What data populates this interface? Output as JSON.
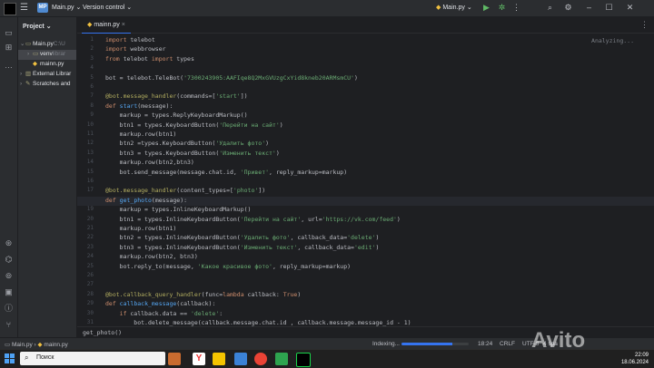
{
  "titlebar": {
    "project_badge": "MP",
    "project_name": "Main.py",
    "vcs": "Version control",
    "run_config": "Main.py"
  },
  "project_panel": {
    "title": "Project",
    "items": [
      {
        "label": "Main.py",
        "hint": "C:\\U",
        "level": 0,
        "expanded": true,
        "selected": false,
        "icon": "folder-icon"
      },
      {
        "label": "venv",
        "hint": "librar",
        "level": 1,
        "expanded": false,
        "selected": true,
        "icon": "folder-icon"
      },
      {
        "label": "mainn.py",
        "hint": "",
        "level": 1,
        "expanded": false,
        "selected": false,
        "icon": "python-file-icon"
      },
      {
        "label": "External Librar",
        "hint": "",
        "level": 0,
        "expanded": false,
        "selected": false,
        "icon": "library-icon"
      },
      {
        "label": "Scratches and",
        "hint": "",
        "level": 0,
        "expanded": false,
        "selected": false,
        "icon": "scratches-icon"
      }
    ]
  },
  "editor": {
    "tab": "mainn.py",
    "analyzing": "Analyzing...",
    "active_line": 18,
    "lines": [
      "import telebot",
      "import webbrowser",
      "from telebot import types",
      "",
      "bot = telebot.TeleBot('7300243905:AAFIqe8Q2MxGVUzgCxYid8kneb20ARMsmCU')",
      "",
      "@bot.message_handler(commands=['start'])",
      "def start(message):",
      "    markup = types.ReplyKeyboardMarkup()",
      "    btn1 = types.KeyboardButton('Перейти на сайт')",
      "    markup.row(btn1)",
      "    btn2 =types.KeyboardButton('Удалить фото')",
      "    btn3 = types.KeyboardButton('Изменить текст')",
      "    markup.row(btn2,btn3)",
      "    bot.send_message(message.chat.id, 'Привет', reply_markup=markup)",
      "",
      "@bot.message_handler(content_types=['photo'])",
      "def get_photo(message):",
      "    markup = types.InlineKeyboardMarkup()",
      "    btn1 = types.InlineKeyboardButton('Перейти на сайт', url='https://vk.com/feed')",
      "    markup.row(btn1)",
      "    btn2 = types.InlineKeyboardButton('Удалить фото', callback_data='delete')",
      "    btn3 = types.InlineKeyboardButton('Изменить текст', callback_data='edit')",
      "    markup.row(btn2, btn3)",
      "    bot.reply_to(message, 'Какое красивое фото', reply_markup=markup)",
      "",
      "",
      "@bot.callback_query_handler(func=lambda callback: True)",
      "def callback_message(callback):",
      "    if callback.data == 'delete':",
      "        bot.delete_message(callback.message.chat.id , callback.message.message_id - 1)"
    ]
  },
  "breadcrumb": "get_photo()",
  "statusbar": {
    "path_root": "Main.py",
    "path_file": "mainn.py",
    "indexing": "Indexing...",
    "progress": 0.75,
    "position": "18:24",
    "line_ending": "CRLF",
    "encoding": "UTF-8",
    "indent": "4 spa"
  },
  "taskbar": {
    "search_placeholder": "Поиск",
    "time": "22:09",
    "date": "18.06.2024"
  },
  "watermark": "Avito"
}
